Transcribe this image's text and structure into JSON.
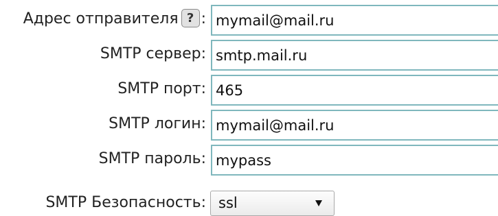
{
  "form": {
    "sender_address": {
      "label": "Адрес отправителя",
      "help": "?",
      "colon": ":",
      "value": "mymail@mail.ru"
    },
    "smtp_server": {
      "label": "SMTP сервер:",
      "value": "smtp.mail.ru"
    },
    "smtp_port": {
      "label": "SMTP порт:",
      "value": "465"
    },
    "smtp_login": {
      "label": "SMTP логин:",
      "value": "mymail@mail.ru"
    },
    "smtp_password": {
      "label": "SMTP пароль:",
      "value": "mypass"
    },
    "smtp_security": {
      "label": "SMTP Безопасность:",
      "value": "ssl"
    }
  },
  "colors": {
    "input_border": "#7fb7bd",
    "text": "#222222",
    "background": "#ffffff"
  },
  "icons": {
    "help": "question-mark-icon",
    "dropdown": "triangle-down-icon"
  }
}
